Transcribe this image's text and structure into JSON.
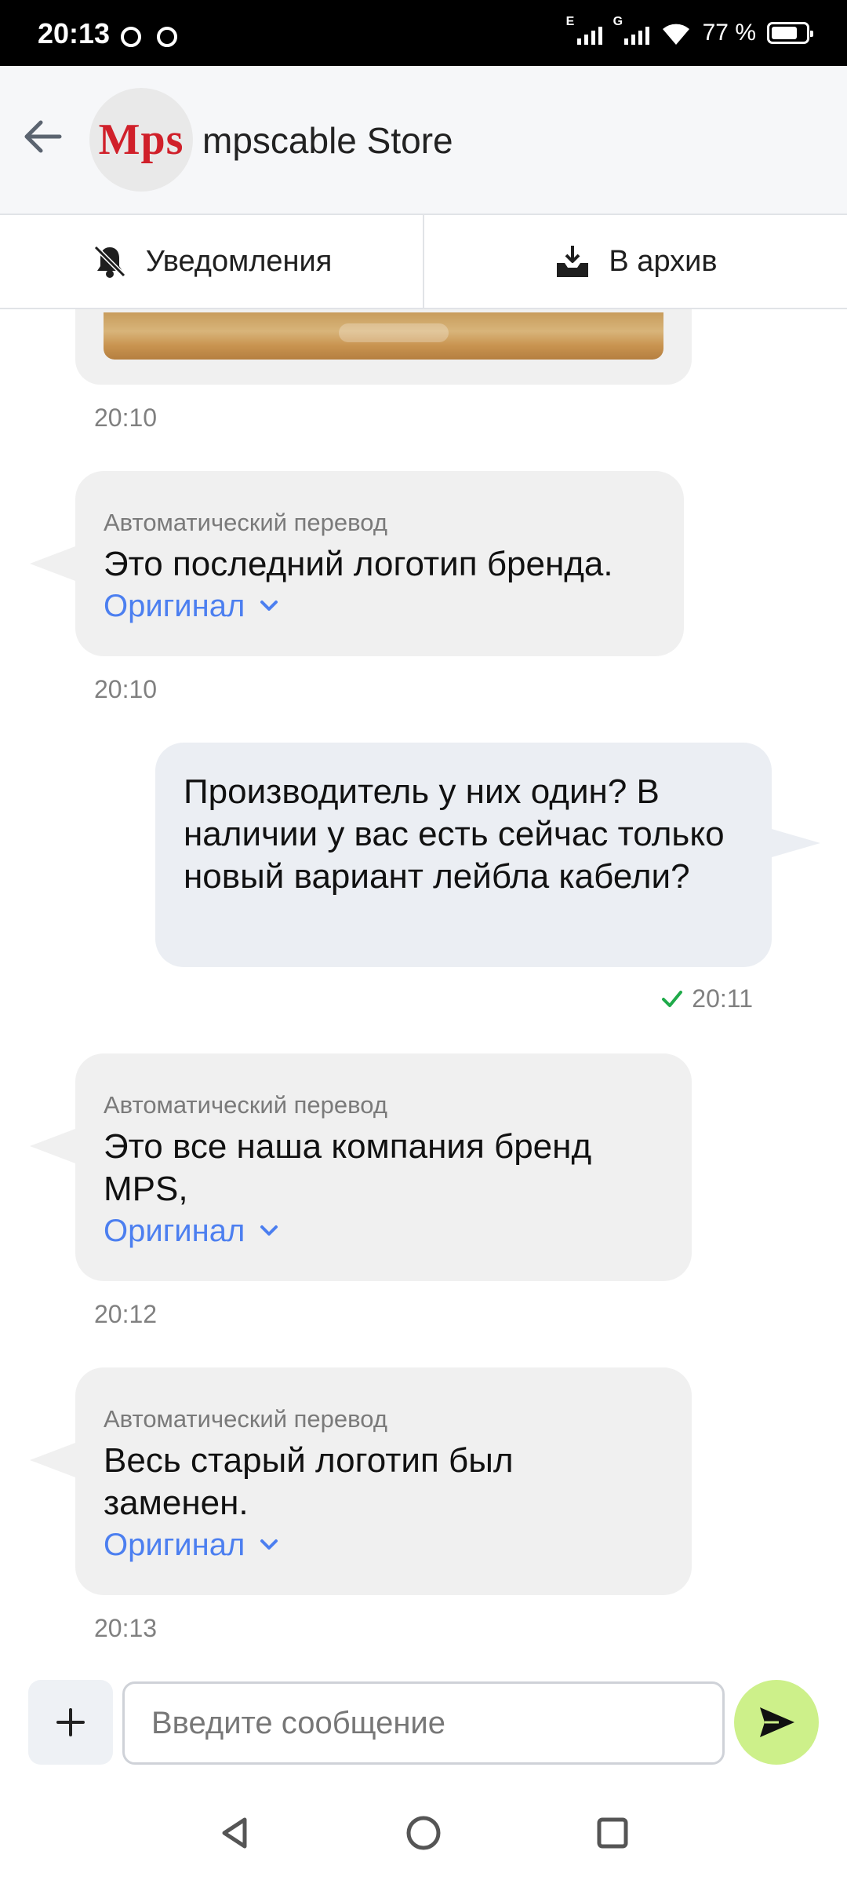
{
  "status_bar": {
    "time": "20:13",
    "signal1_label": "E",
    "signal2_label": "G",
    "battery_percent": "77 %"
  },
  "header": {
    "back_icon": "arrow-left-icon",
    "avatar_logo": "Mps",
    "store_name": "mpscable Store"
  },
  "actions": {
    "notifications_label": "Уведомления",
    "archive_label": "В архив"
  },
  "messages": [
    {
      "direction": "in",
      "type": "image",
      "time": "20:10"
    },
    {
      "direction": "in",
      "auto_label": "Автоматический перевод",
      "text": "Это последний логотип бренда.",
      "original_label": "Оригинал",
      "time": "20:10"
    },
    {
      "direction": "out",
      "text": "Производитель у них один? В наличии у вас есть сейчас только новый вариант лейбла кабели?",
      "time": "20:11",
      "status_color": "#1faa4a"
    },
    {
      "direction": "in",
      "auto_label": "Автоматический перевод",
      "text": "Это все наша компания бренд MPS,",
      "original_label": "Оригинал",
      "time": "20:12"
    },
    {
      "direction": "in",
      "auto_label": "Автоматический перевод",
      "text": "Весь старый логотип был заменен.",
      "original_label": "Оригинал",
      "time": "20:13"
    }
  ],
  "composer": {
    "placeholder": "Введите сообщение",
    "send_color": "#cdf08a"
  },
  "colors": {
    "link": "#4c7ff0",
    "brand": "#d0202a"
  }
}
